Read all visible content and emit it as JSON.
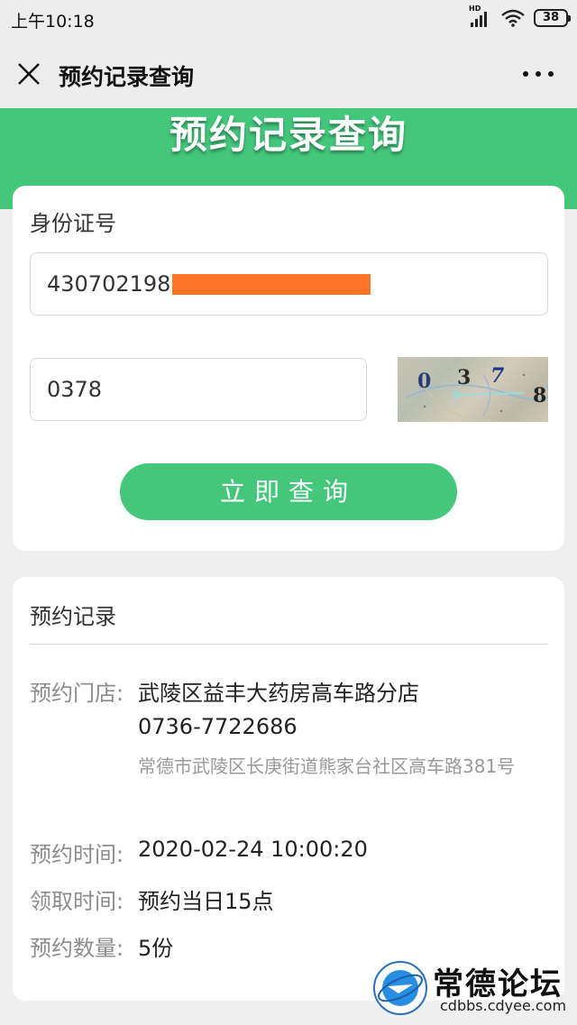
{
  "status_bar": {
    "time": "上午10:18",
    "network": "HD",
    "battery": "38"
  },
  "nav": {
    "title": "预约记录查询"
  },
  "banner": {
    "title": "预约记录查询"
  },
  "form": {
    "id_label": "身份证号",
    "id_value": "430702198",
    "code_value": "0378",
    "captcha_chars": [
      "0",
      "3",
      "7",
      "8"
    ],
    "submit_label": "立即查询"
  },
  "record": {
    "title": "预约记录",
    "store_label": "预约门店:",
    "store_name": "武陵区益丰大药房高车路分店",
    "store_phone": "0736-7722686",
    "store_address": "常德市武陵区长庚街道熊家台社区高车路381号",
    "time_label": "预约时间:",
    "time_value": "2020-02-24 10:00:20",
    "pickup_label": "领取时间:",
    "pickup_value": "预约当日15点",
    "qty_label": "预约数量:",
    "qty_value": "5份"
  },
  "watermark": {
    "site_name": "常德论坛",
    "url": "cdbbs.cdyee.com"
  },
  "colors": {
    "accent": "#44c67b",
    "redaction": "#ff7527"
  }
}
